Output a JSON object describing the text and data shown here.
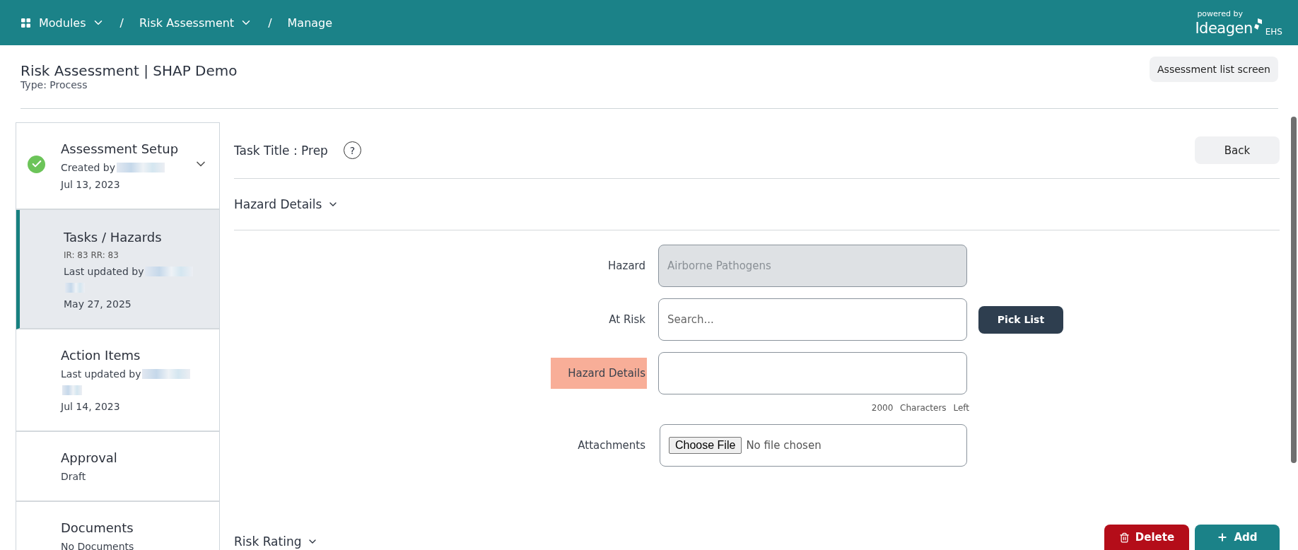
{
  "topbar": {
    "breadcrumbs": [
      {
        "label": "Modules",
        "kind": "menu"
      },
      {
        "label": "Risk Assessment",
        "kind": "menu"
      },
      {
        "label": "Manage",
        "kind": "plain"
      }
    ],
    "separator": "/",
    "brand": {
      "powered": "powered by",
      "name": "Ideagen",
      "suffix": "EHS"
    }
  },
  "page": {
    "title": "Risk Assessment | SHAP Demo",
    "subtitle": "Type: Process",
    "list_button": "Assessment list screen"
  },
  "sidebar": {
    "items": [
      {
        "title": "Assessment Setup",
        "selected": false,
        "completed": true,
        "expandable": true,
        "lines": [
          {
            "kind": "redacted",
            "text": "Created by"
          },
          {
            "kind": "text",
            "text": "Jul 13, 2023"
          }
        ]
      },
      {
        "title": "Tasks / Hazards",
        "selected": true,
        "completed": false,
        "expandable": false,
        "lines": [
          {
            "kind": "small",
            "text": "IR: 83 RR: 83"
          },
          {
            "kind": "redacted",
            "text": "Last updated by"
          },
          {
            "kind": "redaction"
          },
          {
            "kind": "text",
            "text": "May 27, 2025"
          }
        ]
      },
      {
        "title": "Action Items",
        "selected": false,
        "completed": false,
        "expandable": false,
        "lines": [
          {
            "kind": "redacted",
            "text": "Last updated by"
          },
          {
            "kind": "redaction"
          },
          {
            "kind": "text",
            "text": "Jul 14, 2023"
          }
        ]
      },
      {
        "title": "Approval",
        "selected": false,
        "completed": false,
        "expandable": false,
        "lines": [
          {
            "kind": "text",
            "text": "Draft"
          }
        ]
      },
      {
        "title": "Documents",
        "selected": false,
        "completed": false,
        "expandable": false,
        "lines": [
          {
            "kind": "text",
            "text": "No Documents"
          }
        ]
      }
    ]
  },
  "task": {
    "title": "Task Title : Prep",
    "help": "?",
    "back": "Back"
  },
  "hazard_section": {
    "title": "Hazard Details",
    "expanded": true
  },
  "form": {
    "fields": [
      {
        "kind": "readonly",
        "label": "Hazard",
        "value": "Airborne Pathogens",
        "highlighted": false
      },
      {
        "kind": "search",
        "label": "At Risk",
        "placeholder": "Search...",
        "button": "Pick List",
        "highlighted": false
      },
      {
        "kind": "text",
        "label": "Hazard Details",
        "highlighted": true,
        "count": "2000",
        "count_label": "Characters Left"
      },
      {
        "kind": "file",
        "label": "Attachments",
        "button": "Choose File",
        "status": "No file chosen",
        "highlighted": false
      }
    ]
  },
  "risk_section": {
    "title": "Risk Rating",
    "expanded": false,
    "delete": "Delete",
    "add": "Add"
  }
}
